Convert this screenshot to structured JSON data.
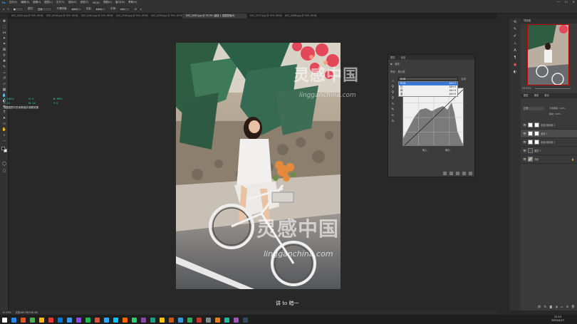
{
  "menu": {
    "items": [
      "文件(F)",
      "编辑(E)",
      "图像(I)",
      "图层(L)",
      "文字(Y)",
      "选择(S)",
      "滤镜(T)",
      "3D(D)",
      "视图(V)",
      "窗口(W)",
      "帮助(H)"
    ],
    "window_buttons": [
      "—",
      "☐",
      "✕"
    ]
  },
  "options_bar": {
    "labels": [
      "模式:",
      "不透明度:",
      "流量:",
      "平滑:"
    ],
    "mode_value": "正常",
    "opacity_value": "100%",
    "flow_value": "100%",
    "smooth_value": "10%"
  },
  "tabs": [
    {
      "label": "DSC_0022.jpg @ 50% (RGB/8)",
      "active": false
    },
    {
      "label": "DSC_0038.jpg @ 50% (RGB/8)",
      "active": false
    },
    {
      "label": "DSC_0041.jpg @ 50% (RGB/8)",
      "active": false
    },
    {
      "label": "DSC_0045.jpg @ 50% (RGB/8)",
      "active": false
    },
    {
      "label": "DSC_0050.jpg @ 50% (RGB/8)",
      "active": false
    },
    {
      "label": "DSC_0061.jpg @ 33.3% (曲线 1, 图层蒙版/8)",
      "active": true
    },
    {
      "label": "DSC_0072.jpg @ 50% (RGB/8)",
      "active": false
    },
    {
      "label": "DSC_0088.jpg @ 50% (RGB/8)",
      "active": false
    }
  ],
  "info_panel": {
    "row1": [
      "R: 240%",
      "G: 0",
      "B: 99%"
    ],
    "row2": [
      "C: 22",
      "M: 14",
      "Y: 0"
    ],
    "message": "调整图层中的参数值并观看效果"
  },
  "curves_panel": {
    "tabs": [
      "属性",
      "信息"
    ],
    "title": "曲线",
    "preset_label": "预设:",
    "preset_value": "默认值",
    "channel_value": "RGB",
    "auto_label": "自动",
    "options": [
      {
        "label": "RGB",
        "shortcut": "Alt+2",
        "selected": true
      },
      {
        "label": "红",
        "shortcut": "Alt+3",
        "selected": false
      },
      {
        "label": "绿",
        "shortcut": "Alt+4",
        "selected": false
      },
      {
        "label": "蓝",
        "shortcut": "Alt+5",
        "selected": false
      }
    ],
    "input_label": "输入:",
    "output_label": "输出:"
  },
  "watermark": {
    "brand_cn": "灵感中国",
    "brand_en": "lingganchina.com"
  },
  "caption": "讲 to 暗一",
  "right_panel": {
    "navigator_tabs": [
      "导航器"
    ],
    "zoom_value": "33.33%",
    "layers_tabs": [
      "图层",
      "通道",
      "路径"
    ],
    "blend_mode": "正常",
    "opacity_label": "不透明度: 100%",
    "fill_label": "填充: 100%",
    "layers": [
      {
        "name": "色相/饱和度 1",
        "selected": false,
        "thumb": "white"
      },
      {
        "name": "曲线 1",
        "selected": true,
        "thumb": "white"
      },
      {
        "name": "色相/饱和度 1",
        "selected": false,
        "thumb": "white"
      },
      {
        "name": "图层 1",
        "selected": false,
        "thumb": "dark"
      },
      {
        "name": "背景",
        "selected": false,
        "thumb": "img"
      }
    ]
  },
  "status_bar": {
    "zoom": "33.33%",
    "doc_info": "文档:68.7M/190.4M"
  },
  "taskbar": {
    "time": "22:10",
    "date": "2023/4/27",
    "icon_colors": [
      "#2b8af0",
      "#f25022",
      "#4caf50",
      "#ffb900",
      "#e63a2e",
      "#0078d7",
      "#3a9cef",
      "#9146ff",
      "#1db954",
      "#e74c3c",
      "#31a8ff",
      "#00c8ff",
      "#ff6a00",
      "#2ecc71",
      "#8e44ad",
      "#16a085",
      "#f1c40f",
      "#d35400",
      "#3498db",
      "#27ae60",
      "#c0392b",
      "#7f8c8d",
      "#e67e22",
      "#1abc9c",
      "#9b59b6",
      "#34495e"
    ]
  },
  "colors": {
    "accent": "#3a78d8",
    "info_text": "#2ddbb5",
    "ui_dark": "#282828",
    "panel": "#323232"
  }
}
